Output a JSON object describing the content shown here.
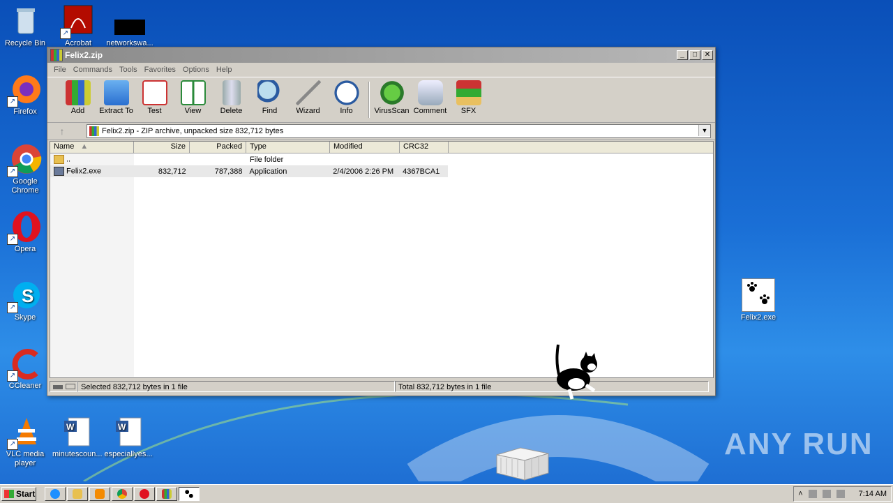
{
  "desktop": {
    "icons": [
      {
        "label": "Recycle Bin",
        "icon": "recycle-bin-icon"
      },
      {
        "label": "Acrobat",
        "icon": "acrobat-icon"
      },
      {
        "label": "networkswa...",
        "icon": "black-thumbnail-icon"
      },
      {
        "label": "Firefox",
        "icon": "firefox-icon"
      },
      {
        "label": "Google Chrome",
        "icon": "chrome-icon"
      },
      {
        "label": "Opera",
        "icon": "opera-icon"
      },
      {
        "label": "Skype",
        "icon": "skype-icon"
      },
      {
        "label": "CCleaner",
        "icon": "ccleaner-icon"
      },
      {
        "label": "VLC media player",
        "icon": "vlc-icon"
      },
      {
        "label": "minutescoun...",
        "icon": "word-doc-icon"
      },
      {
        "label": "especiallyes...",
        "icon": "word-doc-icon"
      },
      {
        "label": "Felix2.exe",
        "icon": "paw-prints-icon"
      }
    ],
    "watermark": "ANY RUN"
  },
  "window": {
    "title": "Felix2.zip",
    "menu": [
      "File",
      "Commands",
      "Tools",
      "Favorites",
      "Options",
      "Help"
    ],
    "toolbar": [
      "Add",
      "Extract To",
      "Test",
      "View",
      "Delete",
      "Find",
      "Wizard",
      "Info",
      "VirusScan",
      "Comment",
      "SFX"
    ],
    "address": "Felix2.zip - ZIP archive, unpacked size 832,712 bytes",
    "columns": [
      "Name",
      "Size",
      "Packed",
      "Type",
      "Modified",
      "CRC32"
    ],
    "rows": [
      {
        "name": "..",
        "size": "",
        "packed": "",
        "type": "File folder",
        "modified": "",
        "crc": ""
      },
      {
        "name": "Felix2.exe",
        "size": "832,712",
        "packed": "787,388",
        "type": "Application",
        "modified": "2/4/2006 2:26 PM",
        "crc": "4367BCA1"
      }
    ],
    "status_left": "Selected 832,712 bytes in 1 file",
    "status_right": "Total 832,712 bytes in 1 file"
  },
  "taskbar": {
    "start": "Start",
    "clock": "7:14 AM"
  }
}
